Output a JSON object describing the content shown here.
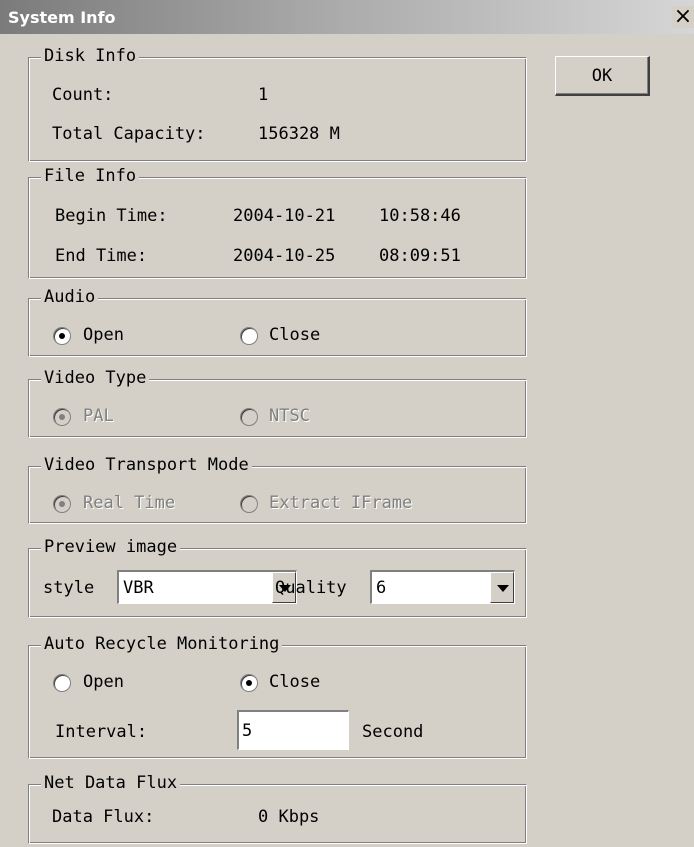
{
  "window": {
    "title": "System Info",
    "close_glyph": "×"
  },
  "ok_button": {
    "label": "OK"
  },
  "disk_info": {
    "legend": "Disk Info",
    "count_label": "Count:",
    "count_value": "1",
    "capacity_label": "Total Capacity:",
    "capacity_value": "156328 M"
  },
  "file_info": {
    "legend": "File Info",
    "begin_label": "Begin Time:",
    "begin_date": "2004-10-21",
    "begin_time": "10:58:46",
    "end_label": "End Time:",
    "end_date": "2004-10-25",
    "end_time": "08:09:51"
  },
  "audio": {
    "legend": "Audio",
    "options": [
      {
        "label": "Open",
        "selected": true
      },
      {
        "label": "Close",
        "selected": false
      }
    ]
  },
  "video_type": {
    "legend": "Video Type",
    "options": [
      {
        "label": "PAL",
        "selected": true,
        "disabled": true
      },
      {
        "label": "NTSC",
        "selected": false,
        "disabled": true
      }
    ]
  },
  "video_transport": {
    "legend": "Video Transport Mode",
    "options": [
      {
        "label": "Real Time",
        "selected": true,
        "disabled": true
      },
      {
        "label": "Extract IFrame",
        "selected": false,
        "disabled": true
      }
    ]
  },
  "preview_image": {
    "legend": "Preview image",
    "style_label": "style",
    "style_value": "VBR",
    "quality_label": "Quality",
    "quality_value": "6"
  },
  "auto_recycle": {
    "legend": "Auto Recycle Monitoring",
    "options": [
      {
        "label": "Open",
        "selected": false
      },
      {
        "label": "Close",
        "selected": true
      }
    ],
    "interval_label": "Interval:",
    "interval_value": "5",
    "interval_unit": "Second"
  },
  "net_data_flux": {
    "legend": "Net Data Flux",
    "flux_label": "Data Flux:",
    "flux_value": "0 Kbps"
  }
}
